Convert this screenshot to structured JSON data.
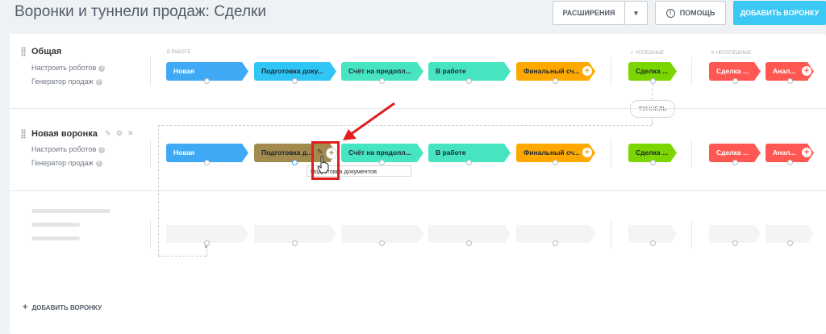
{
  "header": {
    "title": "Воронки и туннели продаж: Сделки",
    "extensions_label": "РАСШИРЕНИЯ",
    "help_label": "ПОМОЩЬ",
    "add_funnel_label": "ДОБАВИТЬ ВОРОНКУ"
  },
  "sections": {
    "in_work": "В РАБОТЕ",
    "success": "УСПЕШНЫЕ",
    "fail": "НЕУСПЕШНЫЕ"
  },
  "funnels": [
    {
      "name": "Общая",
      "robots": "Настроить роботов",
      "generator": "Генератор продаж",
      "stages": [
        "Новая",
        "Подготовка доку...",
        "Счёт на предопл...",
        "В работе",
        "Финальный сч...",
        "Сделка ...",
        "Сделка ...",
        "Анал..."
      ]
    },
    {
      "name": "Новая воронка",
      "robots": "Настроить роботов",
      "generator": "Генератор продаж",
      "stages": [
        "Новая",
        "Подготовка д...",
        "Счёт на предопл...",
        "В работе",
        "Финальный сч...",
        "Сделка ...",
        "Сделка ...",
        "Анал..."
      ]
    }
  ],
  "tunnel_label": "ТУННЕЛЬ",
  "tooltip": "Подготовка документов",
  "footer": {
    "add_funnel": "ДОБАВИТЬ ВОРОНКУ"
  },
  "colors": {
    "new": "#3fa9f5",
    "docs": "#2fc6f6",
    "docs_changed": "#a38a4d",
    "invoice": "#47e4c2",
    "in_work": "#47e4c2",
    "final": "#ffa900",
    "success": "#7bd500",
    "fail": "#ff5752",
    "accent": "#3bc8f5",
    "highlight": "#e02020"
  }
}
